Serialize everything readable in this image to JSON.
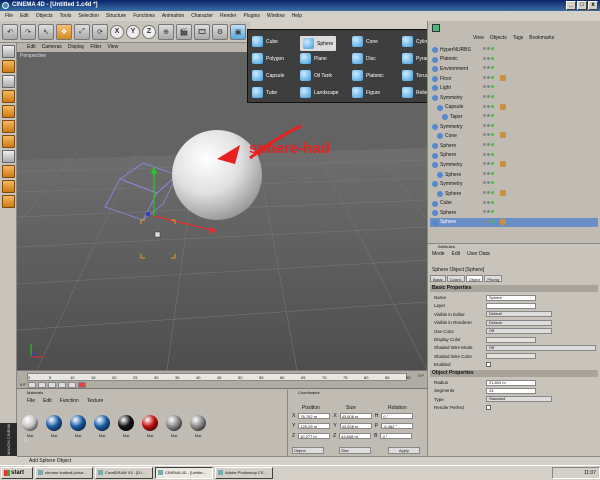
{
  "window": {
    "title": "CINEMA 4D - [Untitled 1.c4d *]",
    "controls": [
      "_",
      "□",
      "x"
    ]
  },
  "menubar": [
    "File",
    "Edit",
    "Objects",
    "Tools",
    "Selection",
    "Structure",
    "Functions",
    "Animation",
    "Character",
    "Render",
    "Plugins",
    "Window",
    "Help"
  ],
  "toolbar": {
    "buttons": [
      "undo-icon",
      "redo-icon",
      "live-select-icon",
      "move-icon",
      "scale-icon",
      "rotate-icon"
    ],
    "axes": [
      "X",
      "Y",
      "Z"
    ]
  },
  "viewport": {
    "menu": [
      "Edit",
      "Cameras",
      "Display",
      "Filter",
      "View"
    ],
    "label": "Perspective",
    "annotation": "sphere-had"
  },
  "primitive_popup": {
    "items": [
      {
        "label": "Cube",
        "icon": "cube-icon",
        "color": "#3a9bd8"
      },
      {
        "label": "Sphere",
        "icon": "sphere-icon",
        "color": "#3a9bd8",
        "highlighted": true
      },
      {
        "label": "Cone",
        "icon": "cone-icon",
        "color": "#3a9bd8"
      },
      {
        "label": "Cylinder",
        "icon": "cylinder-icon",
        "color": "#3a9bd8"
      },
      {
        "label": "Polygon",
        "icon": "polygon-icon",
        "color": "#3a9bd8"
      },
      {
        "label": "Plane",
        "icon": "plane-icon",
        "color": "#3a9bd8"
      },
      {
        "label": "Disc",
        "icon": "disc-icon",
        "color": "#3a9bd8"
      },
      {
        "label": "Pyramid",
        "icon": "pyramid-icon",
        "color": "#3a9bd8"
      },
      {
        "label": "Capsule",
        "icon": "capsule-icon",
        "color": "#3a9bd8"
      },
      {
        "label": "Oil Tank",
        "icon": "oil-tank-icon",
        "color": "#3a9bd8"
      },
      {
        "label": "Platonic",
        "icon": "platonic-icon",
        "color": "#3a9bd8"
      },
      {
        "label": "Torus",
        "icon": "torus-icon",
        "color": "#3a9bd8"
      },
      {
        "label": "Tube",
        "icon": "tube-icon",
        "color": "#3a9bd8"
      },
      {
        "label": "Landscape",
        "icon": "landscape-icon",
        "color": "#3a9bd8"
      },
      {
        "label": "Figure",
        "icon": "figure-icon",
        "color": "#3a9bd8"
      },
      {
        "label": "Relief",
        "icon": "relief-icon",
        "color": "#3a9bd8"
      }
    ]
  },
  "object_manager": {
    "menu": [
      "View",
      "Objects",
      "Tags",
      "Bookmarks"
    ],
    "rows": [
      {
        "name": "HyperNURBS",
        "indent": 0
      },
      {
        "name": "Platonic",
        "indent": 0
      },
      {
        "name": "Environment",
        "indent": 0
      },
      {
        "name": "Floor",
        "indent": 0
      },
      {
        "name": "Light",
        "indent": 0
      },
      {
        "name": "Symmetry",
        "indent": 0
      },
      {
        "name": "Capsule",
        "indent": 1
      },
      {
        "name": "Taper",
        "indent": 2
      },
      {
        "name": "Symmetry",
        "indent": 0
      },
      {
        "name": "Cone",
        "indent": 1
      },
      {
        "name": "Sphere",
        "indent": 0
      },
      {
        "name": "Sphere",
        "indent": 0
      },
      {
        "name": "Symmetry",
        "indent": 0
      },
      {
        "name": "Sphere",
        "indent": 1
      },
      {
        "name": "Symmetry",
        "indent": 0
      },
      {
        "name": "Sphere",
        "indent": 1
      },
      {
        "name": "Cube",
        "indent": 0
      },
      {
        "name": "Sphere",
        "indent": 0
      },
      {
        "name": "Sphere",
        "indent": 0,
        "selected": true
      }
    ]
  },
  "attributes": {
    "panel_title": "Attributes",
    "menu": [
      "Mode",
      "Edit",
      "User Data"
    ],
    "object_title": "Sphere Object [Sphere]",
    "tabs": [
      "Basic",
      "Coord.",
      "Object",
      "Phong"
    ],
    "active_tab": "Object",
    "basic_section": "Basic Properties",
    "basic": [
      {
        "label": "Name",
        "value": "Sphere",
        "kind": "text"
      },
      {
        "label": "Layer",
        "value": "",
        "kind": "text"
      },
      {
        "label": "Visible in Editor",
        "value": "Default",
        "kind": "dd"
      },
      {
        "label": "Visible in Renderer",
        "value": "Default",
        "kind": "dd"
      },
      {
        "label": "Use Color",
        "value": "Off",
        "kind": "dd"
      },
      {
        "label": "Display Color",
        "value": "",
        "kind": "dis"
      },
      {
        "label": "Shaded Wire Mode",
        "value": "Off",
        "kind": "wide"
      },
      {
        "label": "Shaded Wire Color",
        "value": "",
        "kind": "dis"
      },
      {
        "label": "Enabled",
        "value": "",
        "kind": "check"
      },
      {
        "label": "X-Ray",
        "value": "",
        "kind": "check"
      }
    ],
    "object_section": "Object Properties",
    "object": [
      {
        "label": "Radius",
        "value": "21.804 m",
        "kind": "text"
      },
      {
        "label": "Segments",
        "value": "24",
        "kind": "text"
      },
      {
        "label": "Type",
        "value": "Standard",
        "kind": "dd"
      },
      {
        "label": "Render Perfect",
        "value": "",
        "kind": "check"
      }
    ]
  },
  "timeline": {
    "ticks": [
      "0",
      "5",
      "10",
      "15",
      "20",
      "25",
      "30",
      "35",
      "40",
      "45",
      "50",
      "55",
      "60",
      "65",
      "70",
      "75",
      "80",
      "85",
      "90"
    ],
    "start": "0 F",
    "end": "0 F"
  },
  "materials": {
    "menu": [
      "File",
      "Edit",
      "Function",
      "Texture"
    ],
    "items": [
      {
        "label": "Mat",
        "color": "#c8c8c8"
      },
      {
        "label": "Mat",
        "color": "#1a5fa8"
      },
      {
        "label": "Mat",
        "color": "#1a5fa8"
      },
      {
        "label": "Mat",
        "color": "#1a5fa8"
      },
      {
        "label": "Mat",
        "color": "#111111"
      },
      {
        "label": "Mat",
        "color": "#c01010"
      },
      {
        "label": "Mat",
        "color": "#888888"
      },
      {
        "label": "Mat",
        "color": "#8a8a8a"
      }
    ]
  },
  "coordinates": {
    "headers": [
      "Position",
      "Size",
      "Rotation"
    ],
    "rows": [
      {
        "axis": "X",
        "pos": "76.762 m",
        "sax": "X",
        "size": "43.608 m",
        "rax": "H",
        "rot": "0 °"
      },
      {
        "axis": "Y",
        "pos": "125.05 m",
        "sax": "Y",
        "size": "43.608 m",
        "rax": "P",
        "rot": "-6.382 °"
      },
      {
        "axis": "Z",
        "pos": "10.277 m",
        "sax": "Z",
        "size": "43.608 m",
        "rax": "B",
        "rot": "0 °"
      }
    ],
    "mode1": "Object",
    "mode2": "Size",
    "apply": "Apply"
  },
  "statusbar": {
    "text": "Add Sphere Object"
  },
  "brand": "MAXON CINEMA 4D",
  "taskbar": {
    "start": "start",
    "tasks": [
      {
        "label": "chrome football pictur...",
        "active": false
      },
      {
        "label": "CorelDRAW X3 - [D:\\...",
        "active": false
      },
      {
        "label": "CINEMA 4D - [Untitle...",
        "active": true
      },
      {
        "label": "Adobe Photoshop CS...",
        "active": false
      }
    ],
    "clock": "11:07"
  },
  "colors": {
    "accent_orange": "#e08020",
    "annotation_red": "#e82020",
    "viewport_bg": "#5f5f5f",
    "selection_blue": "#6a8ec6"
  }
}
